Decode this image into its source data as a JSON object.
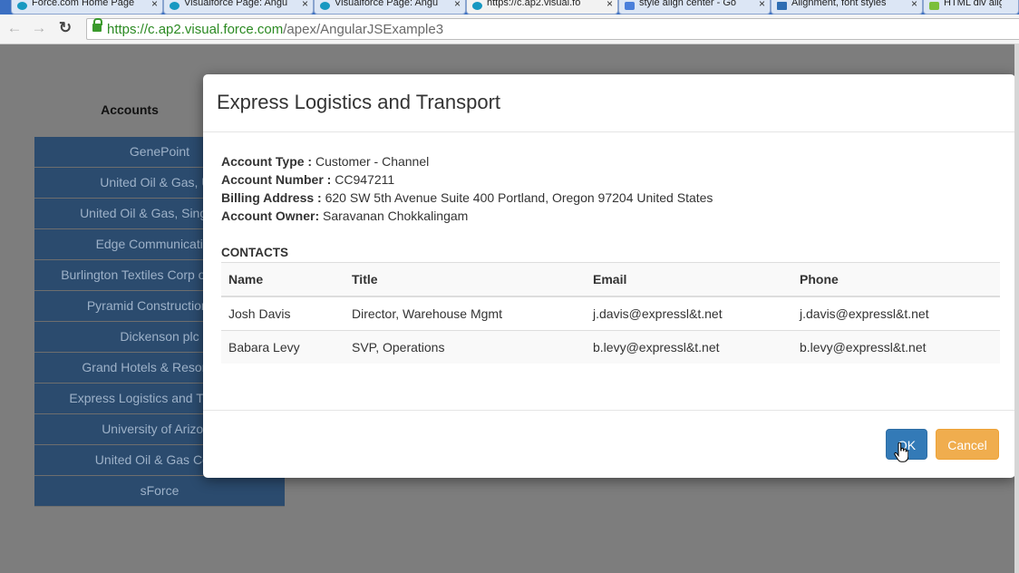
{
  "browser": {
    "tabs": [
      {
        "label": "Force.com Home Page",
        "icon": "cloud-icon",
        "active": false
      },
      {
        "label": "Visualforce Page: Angu",
        "icon": "cloud-icon",
        "active": false
      },
      {
        "label": "Visualforce Page: Angu",
        "icon": "cloud-icon",
        "active": false
      },
      {
        "label": "https://c.ap2.visual.fo",
        "icon": "cloud-icon",
        "active": true
      },
      {
        "label": "style align center - Go",
        "icon": "google-icon",
        "active": false
      },
      {
        "label": "Alignment, font styles",
        "icon": "w3schools-icon",
        "active": false
      },
      {
        "label": "HTML div align",
        "icon": "html-icon",
        "active": false
      }
    ],
    "tab_close": "×",
    "url_secure": "https://",
    "url_host": "c.ap2.visual.force.com",
    "url_path": "/apex/AngularJSExample3"
  },
  "page": {
    "accounts_heading": "Accounts",
    "accounts": [
      "GenePoint",
      "United Oil & Gas, UK",
      "United Oil & Gas, Singapore",
      "Edge Communications",
      "Burlington Textiles Corp of America",
      "Pyramid Construction Inc.",
      "Dickenson plc",
      "Grand Hotels & Resorts Ltd",
      "Express Logistics and Transport",
      "University of Arizona",
      "United Oil & Gas Corp.",
      "sForce"
    ]
  },
  "modal": {
    "title": "Express Logistics and Transport",
    "fields": [
      {
        "label": "Account Type :",
        "value": "Customer - Channel"
      },
      {
        "label": "Account Number :",
        "value": "CC947211"
      },
      {
        "label": "Billing Address :",
        "value": "620 SW 5th Avenue Suite 400 Portland, Oregon 97204 United States"
      },
      {
        "label": "Account Owner:",
        "value": "Saravanan Chokkalingam"
      }
    ],
    "contacts_label": "CONTACTS",
    "contacts_columns": [
      "Name",
      "Title",
      "Email",
      "Phone"
    ],
    "contacts": [
      {
        "name": "Josh Davis",
        "title": "Director, Warehouse Mgmt",
        "email": "j.davis@expressl&t.net",
        "phone": "j.davis@expressl&t.net"
      },
      {
        "name": "Babara Levy",
        "title": "SVP, Operations",
        "email": "b.levy@expressl&t.net",
        "phone": "b.levy@expressl&t.net"
      }
    ],
    "ok_label": "OK",
    "cancel_label": "Cancel"
  },
  "colors": {
    "primary_button": "#337ab7",
    "warning_button": "#f0ad4e",
    "account_item": "#2b4b6e",
    "secure_url": "#2b8a22"
  }
}
